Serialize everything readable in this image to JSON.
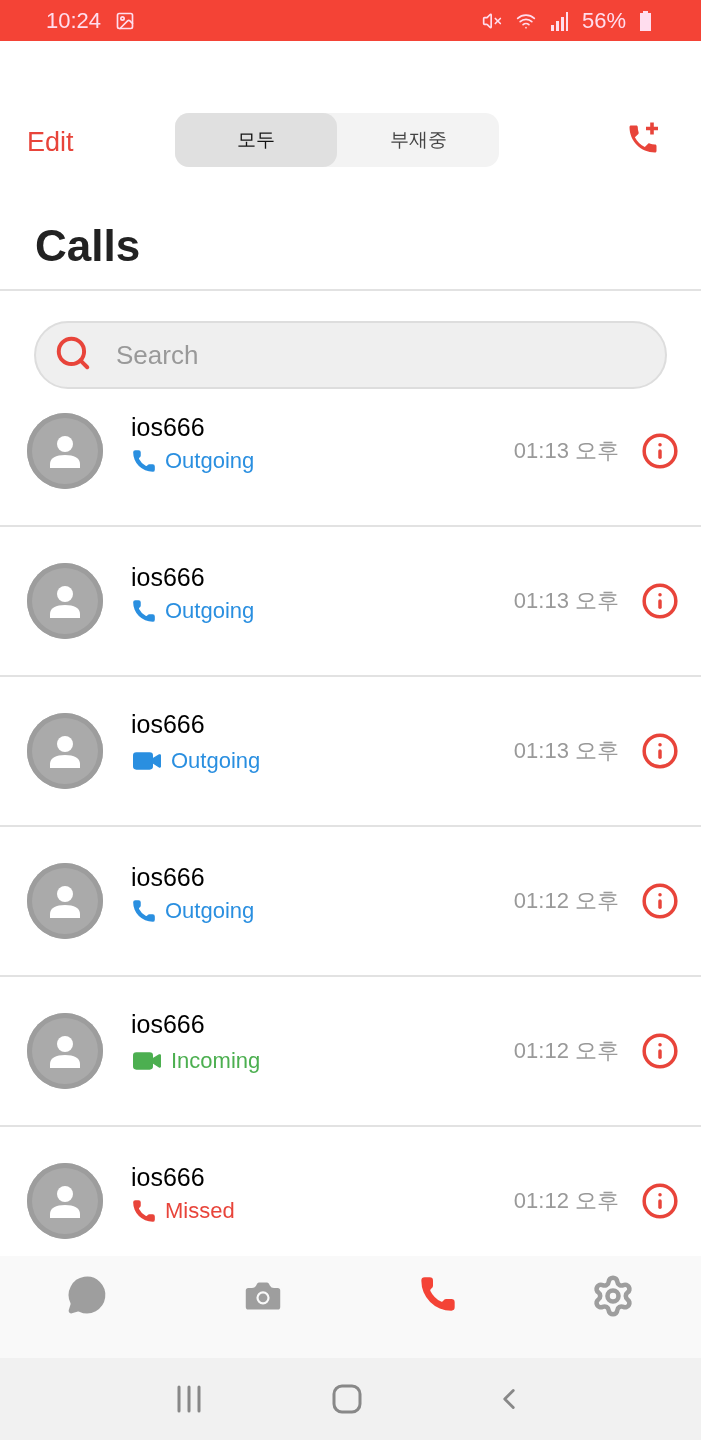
{
  "status_bar": {
    "time": "10:24",
    "battery": "56%"
  },
  "header": {
    "edit": "Edit",
    "segments": [
      {
        "label": "모두",
        "selected": true
      },
      {
        "label": "부재중",
        "selected": false
      }
    ]
  },
  "title": "Calls",
  "search": {
    "placeholder": "Search"
  },
  "calls": [
    {
      "name": "ios666",
      "kind": "voice",
      "color": "#2a8fe0",
      "label": "Outgoing",
      "time": "01:13 오후"
    },
    {
      "name": "ios666",
      "kind": "voice",
      "color": "#2a8fe0",
      "label": "Outgoing",
      "time": "01:13 오후"
    },
    {
      "name": "ios666",
      "kind": "video",
      "color": "#2a8fe0",
      "label": "Outgoing",
      "time": "01:13 오후"
    },
    {
      "name": "ios666",
      "kind": "voice",
      "color": "#2a8fe0",
      "label": "Outgoing",
      "time": "01:12 오후"
    },
    {
      "name": "ios666",
      "kind": "video",
      "color": "#4caf50",
      "label": "Incoming",
      "time": "01:12 오후"
    },
    {
      "name": "ios666",
      "kind": "voice",
      "color": "#e8443a",
      "label": "Missed",
      "time": "01:12 오후"
    }
  ],
  "tab_bar": [
    {
      "kind": "chats",
      "selected": false
    },
    {
      "kind": "camera",
      "selected": false
    },
    {
      "kind": "calls",
      "selected": true
    },
    {
      "kind": "settings",
      "selected": false
    }
  ]
}
